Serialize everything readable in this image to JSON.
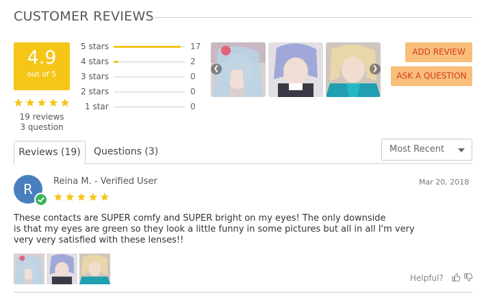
{
  "header": {
    "title": "CUSTOMER REVIEWS"
  },
  "summary": {
    "score": "4.9",
    "score_sub": "out of 5",
    "stars": 5,
    "reviews_count": "19 reviews",
    "questions_count": "3 question"
  },
  "rating_bars": [
    {
      "label": "5 stars",
      "count": "17",
      "fraction": 0.94
    },
    {
      "label": "4 stars",
      "count": "2",
      "fraction": 0.07
    },
    {
      "label": "3 stars",
      "count": "0",
      "fraction": 0
    },
    {
      "label": "2 stars",
      "count": "0",
      "fraction": 0
    },
    {
      "label": "1 star",
      "count": "0",
      "fraction": 0
    }
  ],
  "actions": {
    "add_review": "ADD REVIEW",
    "ask_question": "ASK A QUESTION"
  },
  "tabs": [
    {
      "label": "Reviews (19)",
      "active": true
    },
    {
      "label": "Questions (3)",
      "active": false
    }
  ],
  "sort": {
    "selected": "Most Recent"
  },
  "review": {
    "avatar_letter": "R",
    "author": "Reina M. - Verified User",
    "date": "Mar 20, 2018",
    "rating": 5,
    "text_lines": [
      "These contacts are SUPER comfy and SUPER bright on my eyes! The only downside",
      "is that my eyes are green so they look a little funny in some pictures but all in all I'm very",
      "very very satisfied with these lenses!!"
    ],
    "helpful_label": "Helpful?"
  },
  "colors": {
    "accent": "#f5c518",
    "button_bg": "#f8be7a",
    "button_text": "#d63b1f",
    "avatar": "#4a7fbf",
    "verified": "#3db35a"
  },
  "icons": {
    "star": "star-icon",
    "prev": "chevron-left-icon",
    "next": "chevron-right-icon",
    "thumbs_up": "thumbs-up-icon",
    "thumbs_down": "thumbs-down-icon",
    "caret": "caret-down-icon",
    "verified": "check-icon"
  }
}
